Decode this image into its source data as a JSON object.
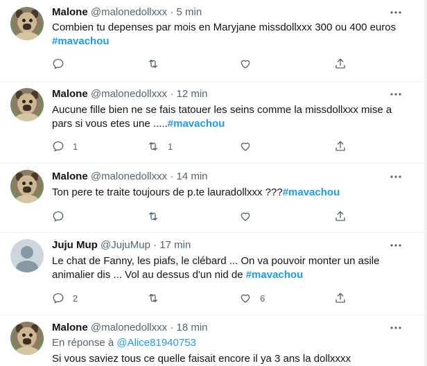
{
  "tweets": [
    {
      "name": "Malone",
      "handle": "@malonedollxxx",
      "dot": "·",
      "time": "5 min",
      "avatar": "pug-dog-avatar",
      "text": "Combien tu depenses par mois en Maryjane missdollxxx  300 ou 400 euros ",
      "hashtag": "#mavachou",
      "reply_count": "",
      "retweet_count": "",
      "like_count": ""
    },
    {
      "name": "Malone",
      "handle": "@malonedollxxx",
      "dot": "·",
      "time": "12 min",
      "avatar": "pug-dog-avatar",
      "text": "Aucune fille bien ne se fais tatouer les seins comme la missdollxxx mise a pars si vous etes une .....",
      "hashtag": "#mavachou",
      "reply_count": "1",
      "retweet_count": "1",
      "like_count": ""
    },
    {
      "name": "Malone",
      "handle": "@malonedollxxx",
      "dot": "·",
      "time": "14 min",
      "avatar": "pug-dog-avatar",
      "text": "Ton pere te traite toujours de p.te lauradollxxx ???",
      "hashtag": "#mavachou",
      "reply_count": "",
      "retweet_count": "",
      "like_count": ""
    },
    {
      "name": "Juju Mup",
      "handle": "@JujuMup",
      "dot": "·",
      "time": "17 min",
      "avatar": "default-avatar",
      "text": "Le chat de Fanny, les piafs, le clébard ... On va pouvoir monter un asile animalier dis ... Vol au dessus d'un nid de ",
      "hashtag": "#mavachou",
      "reply_count": "2",
      "retweet_count": "",
      "like_count": "6"
    },
    {
      "name": "Malone",
      "handle": "@malonedollxxx",
      "dot": "·",
      "time": "18 min",
      "avatar": "pug-dog-avatar",
      "reply_to_label": "En réponse à ",
      "reply_to_user": "@Alice81940753",
      "text": "Si vous saviez tous ce quelle faisait encore il ya 3 ans la dollxxxx"
    }
  ],
  "icons": {
    "more": "more-horizontal-icon",
    "reply": "reply-icon",
    "retweet": "retweet-icon",
    "like": "heart-icon",
    "share": "share-icon"
  },
  "colors": {
    "accent": "#1d9bf0",
    "secondary_text": "#536471",
    "divider": "#eff3f4"
  }
}
